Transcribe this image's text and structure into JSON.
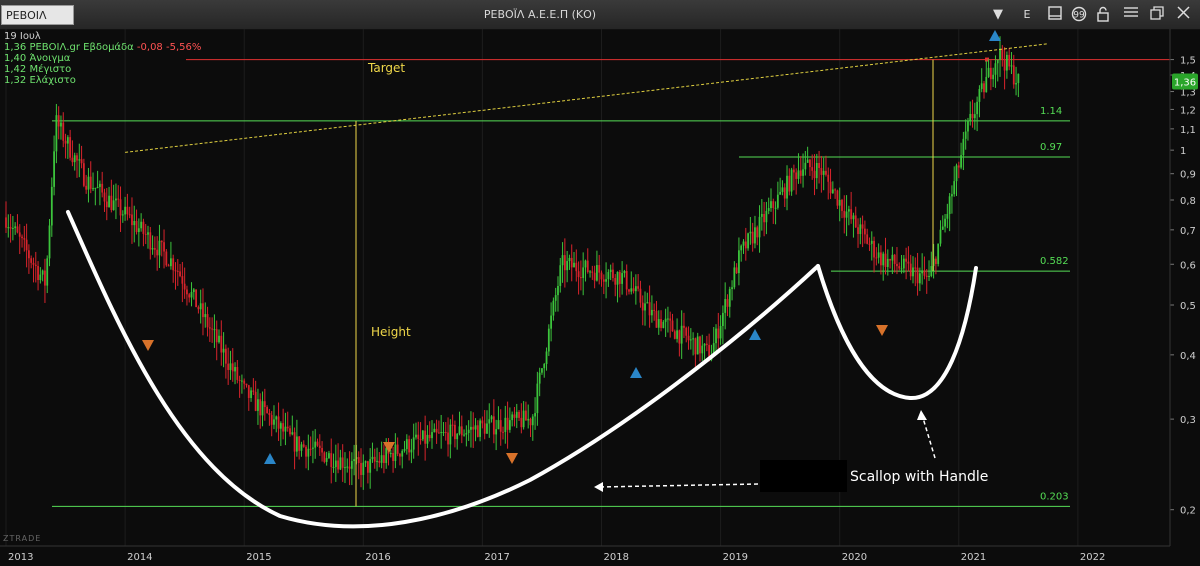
{
  "window": {
    "symbol": "ΡΕΒΟΙΛ",
    "title": "ΡΕΒΟΪΛ Α.Ε.Ε.Π (ΚΟ)",
    "e_label": "E"
  },
  "info": {
    "date": "19 Ιουλ",
    "line1_prefix": "1,36 ΡΕΒΟΙΛ.gr Εβδομάδα",
    "line1_change": "-0,08 -5,56%",
    "open": "1,40 Άνοιγμα",
    "high": "1,42 Μέγιστο",
    "low": "1,32 Ελάχιστο"
  },
  "watermark": "ZTRADE",
  "annotations": {
    "target": "Target",
    "height": "Height",
    "pattern": "Scallop with Handle"
  },
  "colors": {
    "up": "#3cc43c",
    "down": "#d8242c",
    "hline": "#55dd55",
    "trend": "#e0d040",
    "target_line": "#e03030",
    "text_yellow": "#f0d84a",
    "last_price_bg": "#2aa52a"
  },
  "chart_data": {
    "type": "candlestick",
    "timeframe": "weekly",
    "x_ticks": [
      "2013",
      "2014",
      "2015",
      "2016",
      "2017",
      "2018",
      "2019",
      "2020",
      "2021",
      "2022"
    ],
    "y_ticks": [
      "0,2",
      "0,3",
      "0,4",
      "0,5",
      "0,6",
      "0,7",
      "0,8",
      "0,9",
      "1",
      "1,1",
      "1,2",
      "1,3",
      "1,4",
      "1,5"
    ],
    "y_scale": "log",
    "ylim": [
      0.17,
      1.72
    ],
    "last_price": "1,36",
    "levels": [
      {
        "value": 1.14,
        "label": "1.14"
      },
      {
        "value": 0.97,
        "label": "0.97"
      },
      {
        "value": 0.582,
        "label": "0.582"
      },
      {
        "value": 0.203,
        "label": "0.203"
      }
    ],
    "target_level": 1.5,
    "trendline": {
      "from": [
        "2014-01",
        0.99
      ],
      "to": [
        "2021-10",
        1.61
      ]
    },
    "price_path": [
      [
        "2013-01",
        0.74
      ],
      [
        "2013-05",
        0.55
      ],
      [
        "2013-06",
        1.14
      ],
      [
        "2013-09",
        0.88
      ],
      [
        "2014-01",
        0.75
      ],
      [
        "2014-06",
        0.6
      ],
      [
        "2015-01",
        0.34
      ],
      [
        "2015-06",
        0.27
      ],
      [
        "2016-01",
        0.24
      ],
      [
        "2016-06",
        0.27
      ],
      [
        "2017-01",
        0.29
      ],
      [
        "2017-06",
        0.3
      ],
      [
        "2017-09",
        0.6
      ],
      [
        "2018-03",
        0.57
      ],
      [
        "2018-06",
        0.48
      ],
      [
        "2018-12",
        0.4
      ],
      [
        "2019-03",
        0.63
      ],
      [
        "2019-09",
        0.93
      ],
      [
        "2019-11",
        0.92
      ],
      [
        "2020-02",
        0.74
      ],
      [
        "2020-05",
        0.62
      ],
      [
        "2020-10",
        0.56
      ],
      [
        "2020-12",
        0.78
      ],
      [
        "2021-02",
        1.12
      ],
      [
        "2021-04",
        1.4
      ],
      [
        "2021-05",
        1.55
      ],
      [
        "2021-07",
        1.36
      ]
    ]
  }
}
